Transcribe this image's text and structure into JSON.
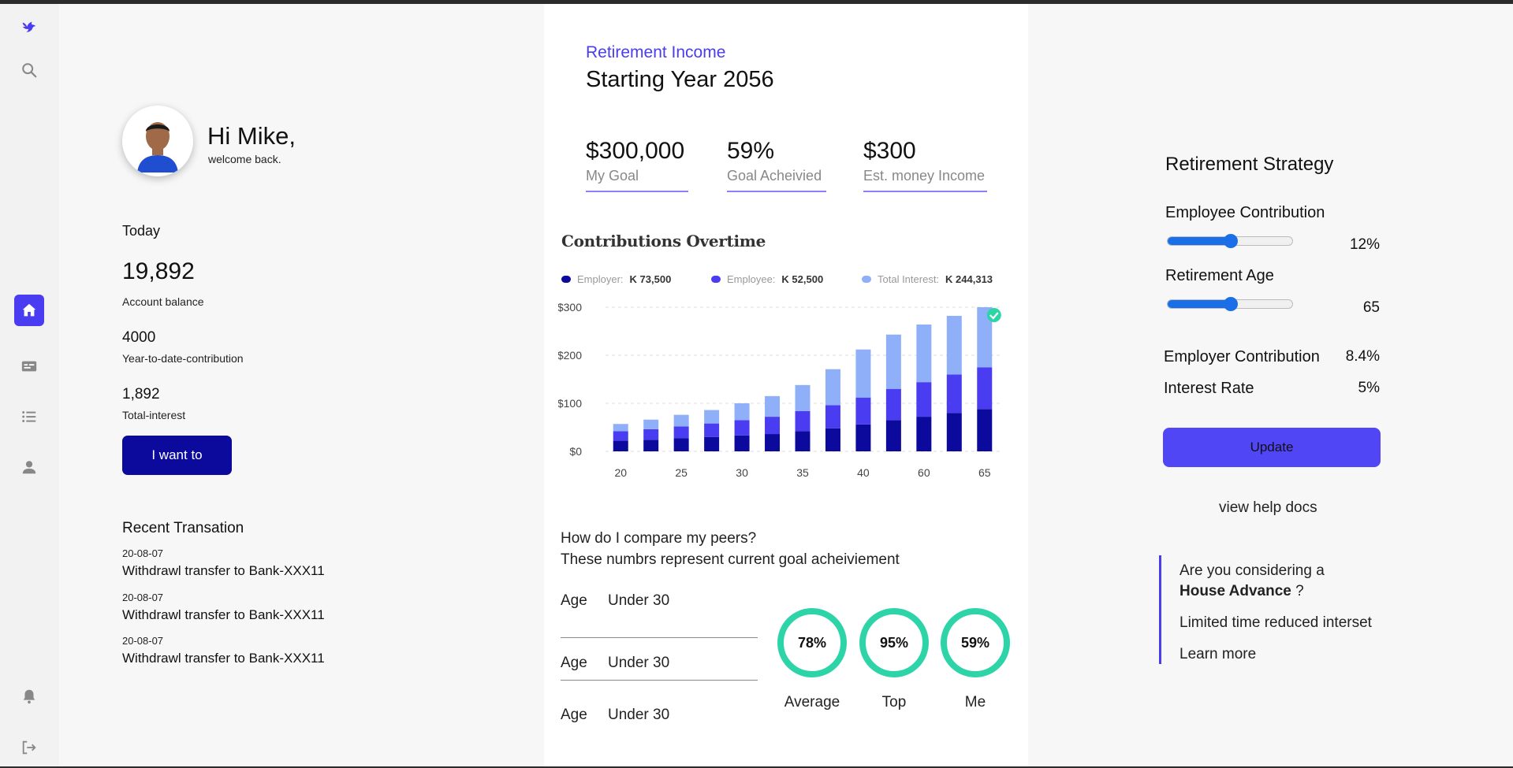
{
  "sidebar": {
    "icons": [
      "logo-bird-icon",
      "search-icon",
      "home-icon",
      "card-icon",
      "list-icon",
      "user-icon",
      "bell-icon",
      "logout-icon"
    ],
    "accent": "#4a3cf0"
  },
  "profile": {
    "greeting": "Hi Mike,",
    "subtitle": "welcome back."
  },
  "summary": {
    "today_label": "Today",
    "balance_value": "19,892",
    "balance_label": "Account balance",
    "ytd_value": "4000",
    "ytd_label": "Year-to-date-contribution",
    "interest_value": "1,892",
    "interest_label": "Total-interest",
    "action_button": "I want to"
  },
  "transactions": {
    "title": "Recent Transation",
    "items": [
      {
        "date": "20-08-07",
        "desc": "Withdrawl transfer to Bank-XXX11"
      },
      {
        "date": "20-08-07",
        "desc": "Withdrawl transfer to Bank-XXX11"
      },
      {
        "date": "20-08-07",
        "desc": "Withdrawl transfer to Bank-XXX11"
      }
    ]
  },
  "income": {
    "label": "Retirement Income",
    "title": "Starting Year 2056",
    "kpis": [
      {
        "value": "$300,000",
        "label": "My Goal"
      },
      {
        "value": "59%",
        "label": "Goal Acheivied"
      },
      {
        "value": "$300",
        "label": "Est. money Income"
      }
    ]
  },
  "chart_data": {
    "type": "bar",
    "title": "Contributions Overtime",
    "stacked": true,
    "categories": [
      "20",
      "",
      "25",
      "",
      "30",
      "",
      "35",
      "",
      "40",
      "",
      "60",
      "",
      "65"
    ],
    "series": [
      {
        "name": "Employer:",
        "total_label": "K 73,500",
        "color": "#0c0a9c",
        "values": [
          22,
          24,
          27,
          30,
          33,
          36,
          42,
          48,
          56,
          65,
          72,
          80,
          88
        ]
      },
      {
        "name": "Employee:",
        "total_label": "K 52,500",
        "color": "#4a3cf0",
        "values": [
          20,
          22,
          25,
          28,
          32,
          36,
          42,
          48,
          56,
          65,
          72,
          80,
          87
        ]
      },
      {
        "name": "Total Interest:",
        "total_label": "K 244,313",
        "color": "#8fb0f8",
        "values": [
          15,
          20,
          24,
          28,
          35,
          43,
          54,
          75,
          100,
          113,
          120,
          122,
          125
        ]
      }
    ],
    "ytick_labels": [
      "$0",
      "$100",
      "$200",
      "$300"
    ],
    "ylim": [
      0,
      300
    ],
    "grid": true,
    "check_marker_on_last": true
  },
  "peers": {
    "question": "How do I compare my peers?",
    "subtitle": "These numbrs represent current goal acheiviement",
    "rows": [
      {
        "key": "Age",
        "value": "Under 30"
      },
      {
        "key": "Age",
        "value": "Under 30"
      },
      {
        "key": "Age",
        "value": "Under 30"
      }
    ],
    "rings": [
      {
        "value": "78%",
        "label": "Average"
      },
      {
        "value": "95%",
        "label": "Top"
      },
      {
        "value": "59%",
        "label": "Me"
      }
    ],
    "ring_color": "#2dd4a7"
  },
  "strategy": {
    "title": "Retirement Strategy",
    "employee_label": "Employee Contribution",
    "employee_value": "12%",
    "employee_slider_level": 0.5,
    "age_label": "Retirement Age",
    "age_value": "65",
    "age_slider_level": 0.5,
    "employer_label": "Employer Contribution",
    "employer_value": "8.4%",
    "interest_label": "Interest Rate",
    "interest_value": "5%",
    "update_button": "Update",
    "help_link": "view help docs",
    "slider_color": "#1a6fe8"
  },
  "promo": {
    "line1": "Are you considering a",
    "highlight": "House Advance",
    "suffix": " ?",
    "line2": "Limited time reduced interset",
    "link": "Learn more"
  }
}
